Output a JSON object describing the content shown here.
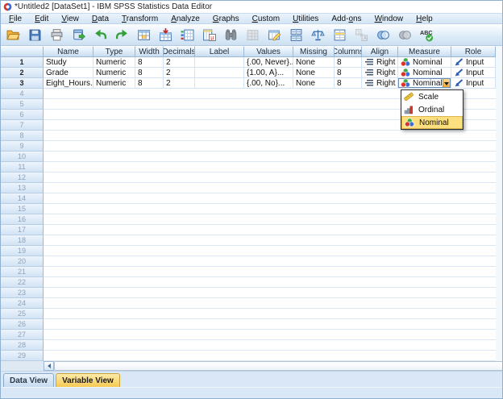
{
  "window_title": "*Untitled2 [DataSet1] - IBM SPSS Statistics Data Editor",
  "menu": {
    "items": [
      {
        "label": "File",
        "accel": 0
      },
      {
        "label": "Edit",
        "accel": 0
      },
      {
        "label": "View",
        "accel": 0
      },
      {
        "label": "Data",
        "accel": 0
      },
      {
        "label": "Transform",
        "accel": 0
      },
      {
        "label": "Analyze",
        "accel": 0
      },
      {
        "label": "Graphs",
        "accel": 0
      },
      {
        "label": "Custom",
        "accel": 0
      },
      {
        "label": "Utilities",
        "accel": 0
      },
      {
        "label": "Add-ons",
        "accel": 4
      },
      {
        "label": "Window",
        "accel": 0
      },
      {
        "label": "Help",
        "accel": 0
      }
    ]
  },
  "toolbar": {
    "icons": [
      {
        "name": "open-data-icon",
        "disabled": false
      },
      {
        "name": "save-icon",
        "disabled": false
      },
      {
        "name": "print-icon",
        "disabled": false
      },
      {
        "name": "recall-dialogs-icon",
        "disabled": false
      },
      {
        "name": "undo-icon",
        "disabled": false
      },
      {
        "name": "redo-icon",
        "disabled": false
      },
      {
        "name": "goto-case-icon",
        "disabled": false
      },
      {
        "name": "goto-variable-icon",
        "disabled": false
      },
      {
        "name": "variables-icon",
        "disabled": false
      },
      {
        "name": "variable-properties-icon",
        "disabled": false
      },
      {
        "name": "find-icon",
        "disabled": false
      },
      {
        "name": "insert-cases-icon",
        "disabled": true
      },
      {
        "name": "insert-variable-icon",
        "disabled": false
      },
      {
        "name": "split-file-icon",
        "disabled": false
      },
      {
        "name": "weight-cases-icon",
        "disabled": false
      },
      {
        "name": "select-cases-icon",
        "disabled": false
      },
      {
        "name": "value-labels-icon",
        "disabled": true
      },
      {
        "name": "use-variable-sets-icon",
        "disabled": false
      },
      {
        "name": "show-all-variables-icon",
        "disabled": false
      },
      {
        "name": "spell-check-icon",
        "disabled": false
      }
    ]
  },
  "grid": {
    "column_headers": [
      "Name",
      "Type",
      "Width",
      "Decimals",
      "Label",
      "Values",
      "Missing",
      "Columns",
      "Align",
      "Measure",
      "Role"
    ],
    "variables": [
      {
        "row": "1",
        "name": "Study",
        "type": "Numeric",
        "width": "8",
        "decimals": "2",
        "label": "",
        "values": "{.00, Never}...",
        "missing": "None",
        "columns": "8",
        "align": "Right",
        "measure": "Nominal",
        "role": "Input",
        "measure_dropdown_open": false
      },
      {
        "row": "2",
        "name": "Grade",
        "type": "Numeric",
        "width": "8",
        "decimals": "2",
        "label": "",
        "values": "{1.00, A}...",
        "missing": "None",
        "columns": "8",
        "align": "Right",
        "measure": "Nominal",
        "role": "Input",
        "measure_dropdown_open": false
      },
      {
        "row": "3",
        "name": "Eight_Hours...",
        "type": "Numeric",
        "width": "8",
        "decimals": "2",
        "label": "",
        "values": "{.00, No}...",
        "missing": "None",
        "columns": "8",
        "align": "Right",
        "measure": "Nominal",
        "role": "Input",
        "measure_dropdown_open": true
      }
    ],
    "empty_rows": {
      "from": 4,
      "to": 29
    }
  },
  "measure_dropdown": {
    "options": [
      {
        "label": "Scale",
        "icon": "scale-icon",
        "highlighted": false
      },
      {
        "label": "Ordinal",
        "icon": "ordinal-icon",
        "highlighted": false
      },
      {
        "label": "Nominal",
        "icon": "nominal-icon",
        "highlighted": true
      }
    ]
  },
  "tabs": {
    "data_view": "Data View",
    "variable_view": "Variable View",
    "active": "Variable View"
  },
  "colors": {
    "tab_active_bg": "#f6ca54",
    "dropdown_highlight": "#fcdf7e",
    "header_bg": "#d7e6f5",
    "grid_line": "#d4e3f3",
    "toolbar_bg": "#dcebf8",
    "nominal_red": "#d8352a",
    "nominal_green": "#3fae49",
    "nominal_blue": "#3b6fd4",
    "combo_button_orange": "#f0a93c"
  }
}
